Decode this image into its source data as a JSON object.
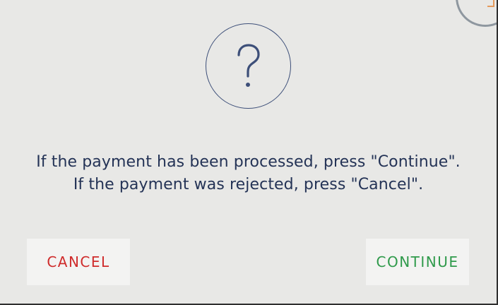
{
  "dialog": {
    "message_line_1": "If the payment has been processed, press \"Continue\".",
    "message_line_2": "If the payment was rejected, press \"Cancel\".",
    "icon": "question-icon"
  },
  "buttons": {
    "cancel_label": "CANCEL",
    "continue_label": "CONTINUE"
  },
  "colors": {
    "dialog_background": "#e8e8e6",
    "text": "#243356",
    "cancel": "#cf2b2b",
    "continue": "#2f9a4b",
    "button_background": "#f3f3f2",
    "icon_stroke": "#3d4f79"
  }
}
